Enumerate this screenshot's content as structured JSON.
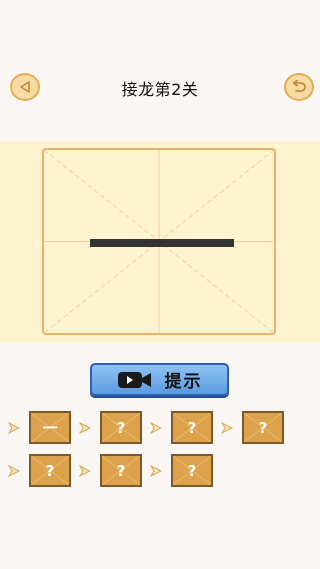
{
  "header": {
    "title": "接龙第2关"
  },
  "board": {
    "character": "一"
  },
  "hint": {
    "label": "提示"
  },
  "chain": {
    "row1": [
      "一",
      "?",
      "?",
      "?"
    ],
    "row2": [
      "?",
      "?",
      "?"
    ]
  },
  "colors": {
    "background": "#faf6f3",
    "board_background": "#fdf3cf",
    "board_border": "#e5b46a",
    "tile": "#dca24c",
    "hint_button": "#5b9be0",
    "stroke": "#333333"
  },
  "icons": {
    "back": "triangle-left-icon",
    "reset": "undo-icon",
    "video": "video-camera-icon",
    "chain_arrow": "chevron-right-icon"
  }
}
